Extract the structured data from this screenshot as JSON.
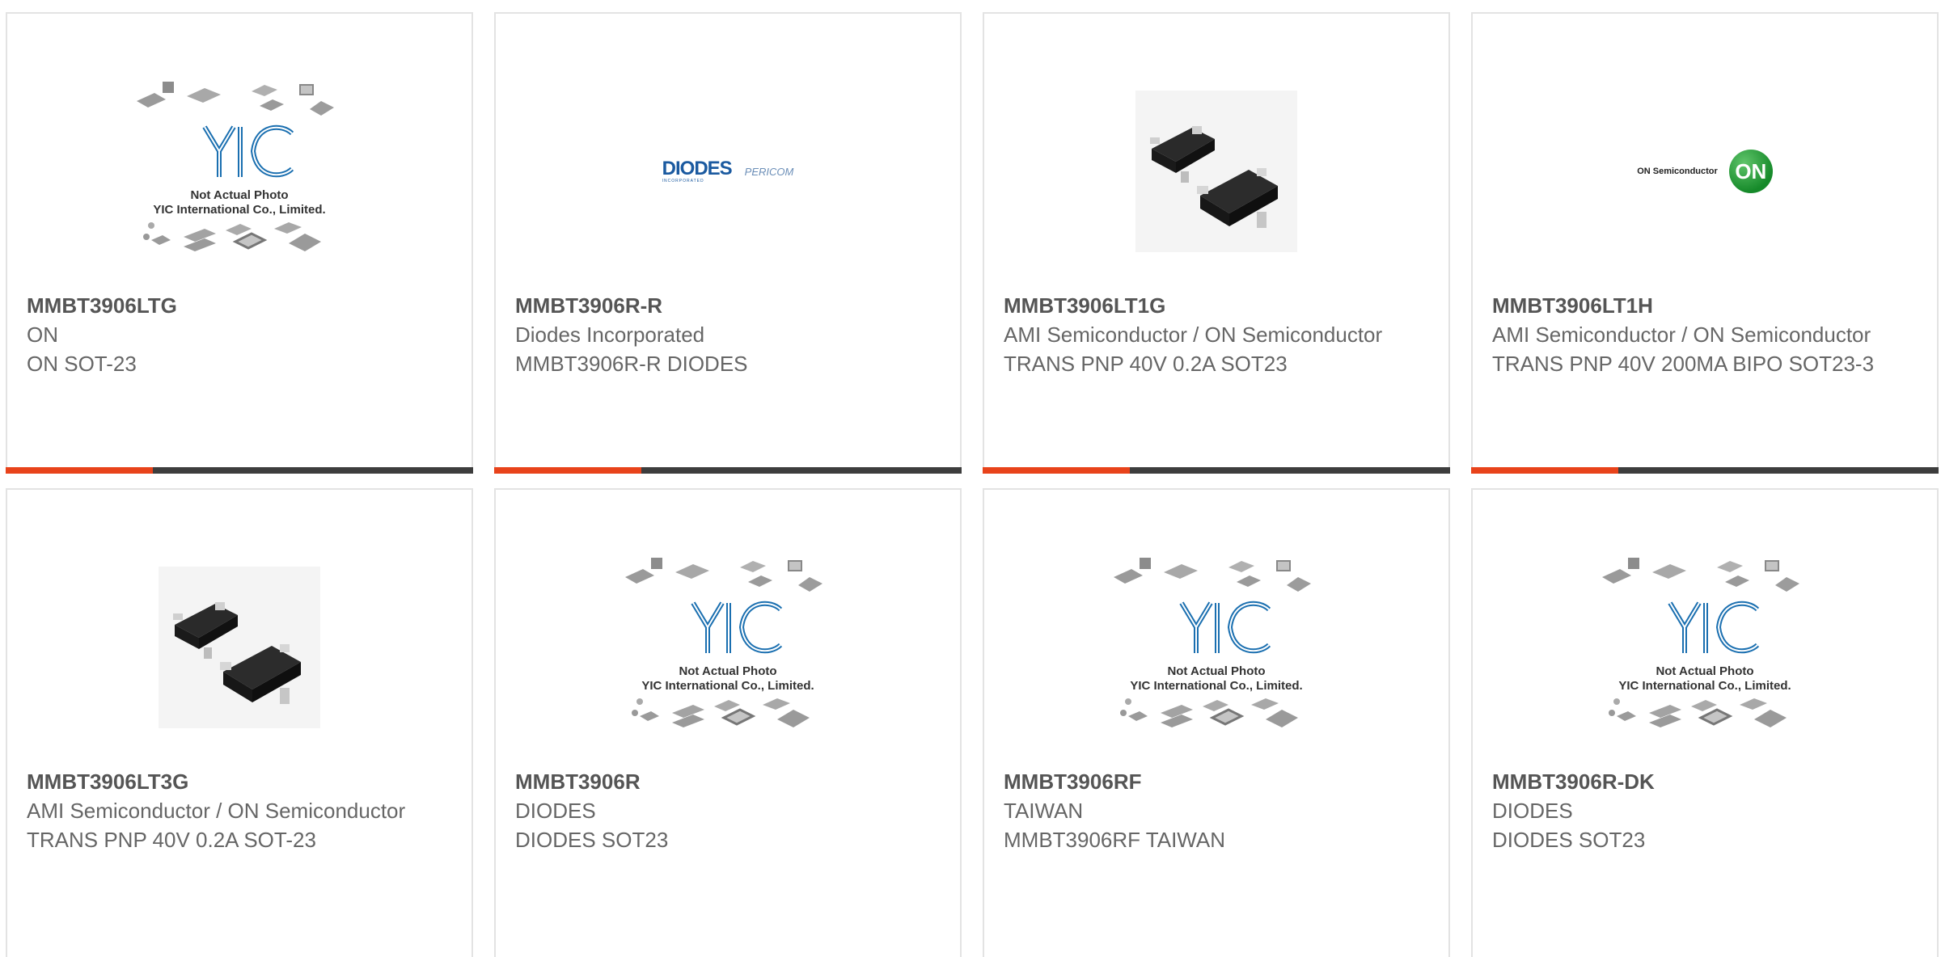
{
  "placeholder": {
    "line1": "Not Actual Photo",
    "line2": "YIC International Co., Limited.",
    "brand": "YIC"
  },
  "logos": {
    "diodes": "DIODES",
    "diodes_sub": "INCORPORATED",
    "pericom": "PERICOM",
    "on_name": "ON Semiconductor",
    "on_mark": "ON"
  },
  "colors": {
    "accent": "#e8431b",
    "bar": "#3d3d3d",
    "part_text": "#555555",
    "body_text": "#666666",
    "card_border": "#e3e3e3"
  },
  "products": [
    {
      "part": "MMBT3906LTG",
      "manufacturer": "ON",
      "description": "ON SOT-23",
      "image": "placeholder-image"
    },
    {
      "part": "MMBT3906R-R",
      "manufacturer": "Diodes Incorporated",
      "description": "MMBT3906R-R DIODES",
      "image": "diodes-pericom-logo"
    },
    {
      "part": "MMBT3906LT1G",
      "manufacturer": "AMI Semiconductor / ON Semiconductor",
      "description": "TRANS PNP 40V 0.2A SOT23",
      "image": "sot23-photo"
    },
    {
      "part": "MMBT3906LT1H",
      "manufacturer": "AMI Semiconductor / ON Semiconductor",
      "description": "TRANS PNP 40V 200MA BIPO SOT23-3",
      "image": "on-semiconductor-logo"
    },
    {
      "part": "MMBT3906LT3G",
      "manufacturer": "AMI Semiconductor / ON Semiconductor",
      "description": "TRANS PNP 40V 0.2A SOT-23",
      "image": "sot23-photo"
    },
    {
      "part": "MMBT3906R",
      "manufacturer": "DIODES",
      "description": "DIODES SOT23",
      "image": "placeholder-image"
    },
    {
      "part": "MMBT3906RF",
      "manufacturer": "TAIWAN",
      "description": "MMBT3906RF TAIWAN",
      "image": "placeholder-image"
    },
    {
      "part": "MMBT3906R-DK",
      "manufacturer": "DIODES",
      "description": "DIODES SOT23",
      "image": "placeholder-image"
    }
  ]
}
